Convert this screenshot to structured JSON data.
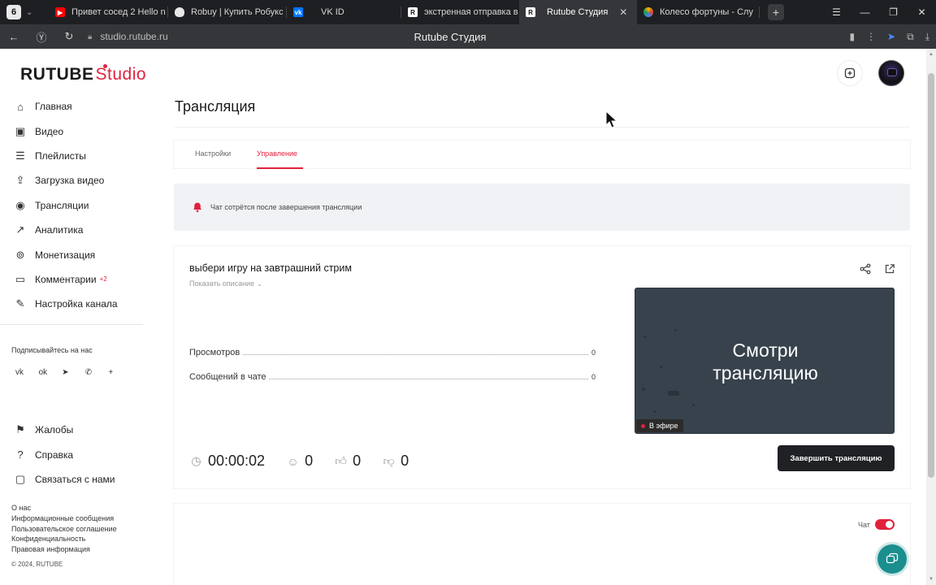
{
  "browser": {
    "tab_counter": "6",
    "tabs": [
      {
        "label": "Привет сосед 2 Hello n",
        "favicon": "youtube-icon",
        "color": "#ff0000"
      },
      {
        "label": "Robuy | Купить Робукс",
        "favicon": "shield-icon",
        "color": "#dddddd"
      },
      {
        "label": "VK ID",
        "favicon": "vk-icon",
        "color": "#0077ff"
      },
      {
        "label": "экстренная отправка в",
        "favicon": "rutube-icon",
        "color": "#ffffff"
      },
      {
        "label": "Rutube Студия",
        "favicon": "rutube-icon",
        "color": "#ffffff",
        "active": true
      },
      {
        "label": "Колесо фортуны - Слу",
        "favicon": "wheel-icon",
        "color": "#f4b400"
      }
    ],
    "url": "studio.rutube.ru",
    "page_title": "Rutube Студия"
  },
  "brand": {
    "name": "RUTUBE",
    "suffix": "Studio",
    "accent": "#e0223d"
  },
  "sidebar": {
    "items": [
      {
        "label": "Главная",
        "icon": "home-icon"
      },
      {
        "label": "Видео",
        "icon": "video-icon"
      },
      {
        "label": "Плейлисты",
        "icon": "playlist-icon"
      },
      {
        "label": "Загрузка видео",
        "icon": "upload-icon"
      },
      {
        "label": "Трансляции",
        "icon": "broadcast-icon"
      },
      {
        "label": "Аналитика",
        "icon": "analytics-icon"
      },
      {
        "label": "Монетизация",
        "icon": "money-icon"
      },
      {
        "label": "Комментарии",
        "icon": "comments-icon",
        "badge": "+2"
      },
      {
        "label": "Настройка канала",
        "icon": "magic-wand-icon"
      }
    ],
    "subscribe_label": "Подписывайтесь на нас",
    "bottom_items": [
      {
        "label": "Жалобы",
        "icon": "flag-icon"
      },
      {
        "label": "Справка",
        "icon": "help-icon"
      },
      {
        "label": "Связаться с нами",
        "icon": "chat-icon"
      }
    ],
    "footer_links": [
      "О нас",
      "Информационные сообщения",
      "Пользовательское соглашение",
      "Конфиденциальность",
      "Правовая информация"
    ],
    "copyright": "© 2024, RUTUBE"
  },
  "main": {
    "title": "Трансляция",
    "tabs": [
      {
        "label": "Настройки",
        "active": false
      },
      {
        "label": "Управление",
        "active": true
      }
    ],
    "notice": "Чат сотрётся после завершения трансляции",
    "stream": {
      "name": "выбери игру на завтрашний стрим",
      "show_description": "Показать описание",
      "stats": [
        {
          "label": "Просмотров",
          "value": "0"
        },
        {
          "label": "Сообщений в чате",
          "value": "0"
        }
      ],
      "preview_line1": "Смотри",
      "preview_line2": "трансляцию",
      "live_badge": "В эфире",
      "timer": "00:00:02",
      "viewers": "0",
      "likes": "0",
      "dislikes": "0",
      "end_button": "Завершить трансляцию"
    },
    "chat": {
      "label": "Чат",
      "enabled": true
    }
  }
}
